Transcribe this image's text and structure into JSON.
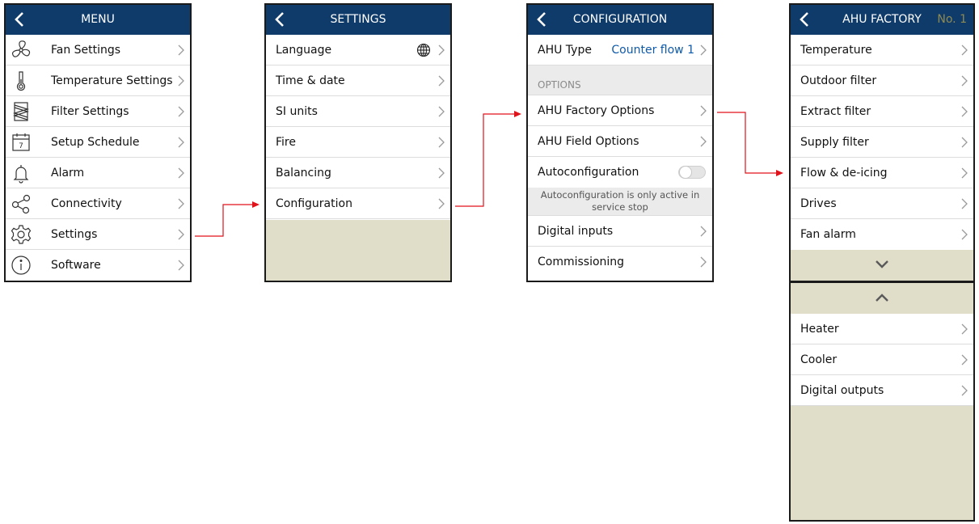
{
  "menu": {
    "title": "MENU",
    "items": [
      {
        "label": "Fan Settings",
        "icon": "fan-icon"
      },
      {
        "label": "Temperature Settings",
        "icon": "thermometer-icon"
      },
      {
        "label": "Filter Settings",
        "icon": "filter-icon"
      },
      {
        "label": "Setup Schedule",
        "icon": "calendar-icon",
        "icon_text": "7"
      },
      {
        "label": "Alarm",
        "icon": "bell-icon"
      },
      {
        "label": "Connectivity",
        "icon": "share-icon"
      },
      {
        "label": "Settings",
        "icon": "gear-icon"
      },
      {
        "label": "Software",
        "icon": "info-icon"
      }
    ]
  },
  "settings": {
    "title": "SETTINGS",
    "items": [
      {
        "label": "Language",
        "icon": "globe-icon"
      },
      {
        "label": "Time & date"
      },
      {
        "label": "SI units"
      },
      {
        "label": "Fire"
      },
      {
        "label": "Balancing"
      },
      {
        "label": "Configuration"
      }
    ]
  },
  "configuration": {
    "title": "CONFIGURATION",
    "ahu_type": {
      "label": "AHU Type",
      "value": "Counter flow 1"
    },
    "section_label": "OPTIONS",
    "options": [
      {
        "label": "AHU Factory Options"
      },
      {
        "label": "AHU Field Options"
      }
    ],
    "autoconfig": {
      "label": "Autoconfiguration",
      "enabled": false,
      "note_line1": "Autoconfiguration is only active in",
      "note_line2": "service stop"
    },
    "more": [
      {
        "label": "Digital inputs"
      },
      {
        "label": "Commissioning"
      }
    ]
  },
  "ahu_factory": {
    "title": "AHU FACTORY",
    "number": "No. 1",
    "items": [
      {
        "label": "Temperature"
      },
      {
        "label": "Outdoor filter"
      },
      {
        "label": "Extract filter"
      },
      {
        "label": "Supply filter"
      },
      {
        "label": "Flow & de-icing"
      },
      {
        "label": "Drives"
      },
      {
        "label": "Fan alarm"
      }
    ],
    "items_page2": [
      {
        "label": "Heater"
      },
      {
        "label": "Cooler"
      },
      {
        "label": "Digital outputs"
      }
    ]
  },
  "colors": {
    "header": "#0f3b6b",
    "accent_value": "#0f5aa8",
    "fill": "#e0ddc9",
    "arrow": "#e0121a"
  }
}
